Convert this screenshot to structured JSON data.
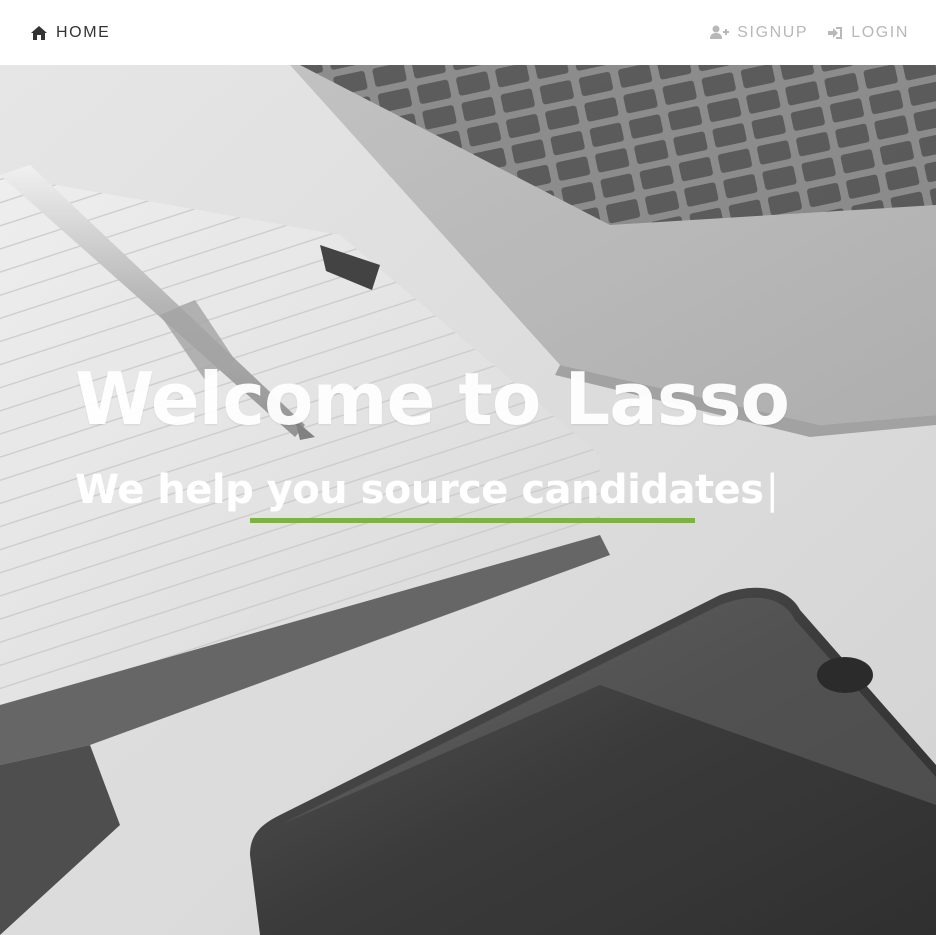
{
  "nav": {
    "home": {
      "label": "HOME",
      "icon": "home-icon"
    },
    "signup": {
      "label": "SIGNUP",
      "icon": "user-plus-icon"
    },
    "login": {
      "label": "LOGIN",
      "icon": "sign-in-icon"
    }
  },
  "hero": {
    "title": "Welcome to Lasso",
    "subtitle": "We help you source candidates",
    "cursor": "|",
    "accent_color": "#7cb342"
  }
}
